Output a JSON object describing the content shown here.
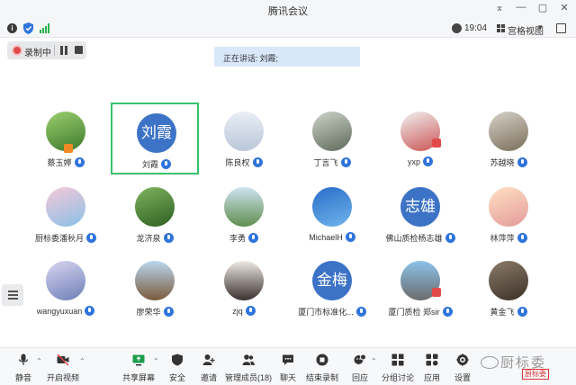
{
  "window": {
    "title": "腾讯会议"
  },
  "infobar": {
    "time": "19:04",
    "view_label": "宫格视图"
  },
  "recording": {
    "label": "录制中"
  },
  "speaking": {
    "prefix": "正在讲话:",
    "name": "刘霞;"
  },
  "participants": [
    {
      "name": "蔡玉婷",
      "avatar": "photo"
    },
    {
      "name": "刘霞",
      "avatar": "text",
      "avatar_text": "刘霞",
      "active": true
    },
    {
      "name": "陈良权",
      "avatar": "photo"
    },
    {
      "name": "丁言飞",
      "avatar": "photo"
    },
    {
      "name": "yxp",
      "avatar": "photo"
    },
    {
      "name": "苏越晓",
      "avatar": "photo"
    },
    {
      "name": "厨标委潘秋月",
      "avatar": "photo"
    },
    {
      "name": "龙济泉",
      "avatar": "photo"
    },
    {
      "name": "李勇",
      "avatar": "photo"
    },
    {
      "name": "MichaelH",
      "avatar": "photo"
    },
    {
      "name": "佛山质检杨志雄",
      "avatar": "text",
      "avatar_text": "志雄"
    },
    {
      "name": "林萍萍",
      "avatar": "photo"
    },
    {
      "name": "wangyuxuan",
      "avatar": "photo"
    },
    {
      "name": "廖荣华",
      "avatar": "photo"
    },
    {
      "name": "zjq",
      "avatar": "photo"
    },
    {
      "name": "厦门市标准化...",
      "avatar": "text",
      "avatar_text": "金梅"
    },
    {
      "name": "厦门质检 郑sir",
      "avatar": "photo"
    },
    {
      "name": "黄金飞",
      "avatar": "photo"
    }
  ],
  "toolbar": {
    "mute": "静音",
    "video": "开启视频",
    "share": "共享屏幕",
    "security": "安全",
    "invite": "邀请",
    "members": "管理成员(18)",
    "chat": "聊天",
    "stop_record": "结束录制",
    "react": "回应",
    "breakout": "分组讨论",
    "apps": "应用",
    "settings": "设置"
  },
  "watermark": {
    "text": "厨标委",
    "stamp": "厨标委"
  },
  "colors": {
    "accent": "#2f74dc",
    "active_border": "#36c36c",
    "recording": "#e24a4a"
  }
}
